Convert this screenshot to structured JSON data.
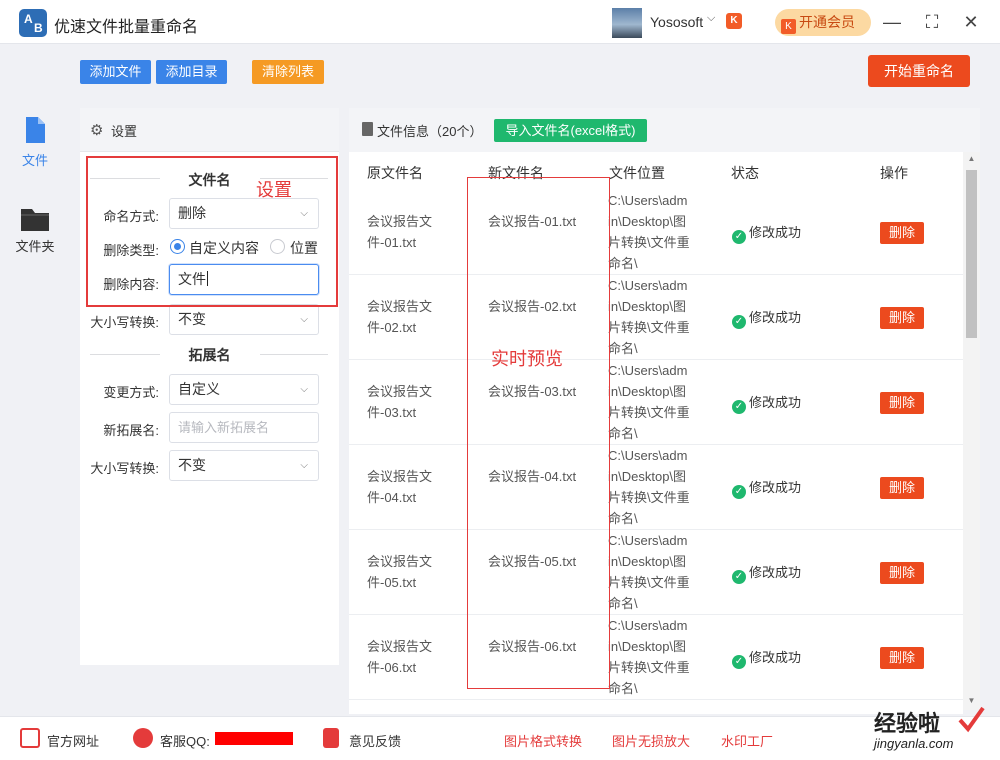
{
  "app": {
    "logo": [
      "A",
      "B"
    ],
    "title": "优速文件批量重命名"
  },
  "user": {
    "name": "Yososoft",
    "vip_button": "开通会员",
    "vip_mark": "K"
  },
  "toolbar": {
    "add_file": "添加文件",
    "add_folder": "添加目录",
    "clear_list": "清除列表",
    "start": "开始重命名"
  },
  "nav": [
    {
      "label": "文件"
    },
    {
      "label": "文件夹"
    }
  ],
  "settings": {
    "header": "设置",
    "filename_section": "文件名",
    "naming_mode_label": "命名方式:",
    "naming_mode_value": "删除",
    "delete_type_label": "删除类型:",
    "delete_type_options": [
      "自定义内容",
      "位置"
    ],
    "delete_content_label": "删除内容:",
    "delete_content_value": "文件",
    "case_label": "大小写转换:",
    "case_value": "不变",
    "ext_section": "拓展名",
    "ext_mode_label": "变更方式:",
    "ext_mode_value": "自定义",
    "new_ext_label": "新拓展名:",
    "new_ext_placeholder": "请输入新拓展名",
    "ext_case_label": "大小写转换:",
    "ext_case_value": "不变"
  },
  "annotations": {
    "settings": "设置",
    "preview": "实时预览"
  },
  "file_panel": {
    "title": "文件信息（20个）",
    "import_button": "导入文件名(excel格式)",
    "columns": [
      "原文件名",
      "新文件名",
      "文件位置",
      "状态",
      "操作"
    ],
    "rows": [
      {
        "orig": "会议报告文件-01.txt",
        "new": "会议报告-01.txt",
        "loc": "C:\\Users\\admin\\Desktop\\图片转换\\文件重命名\\",
        "status": "修改成功",
        "action": "删除"
      },
      {
        "orig": "会议报告文件-02.txt",
        "new": "会议报告-02.txt",
        "loc": "C:\\Users\\admin\\Desktop\\图片转换\\文件重命名\\",
        "status": "修改成功",
        "action": "删除"
      },
      {
        "orig": "会议报告文件-03.txt",
        "new": "会议报告-03.txt",
        "loc": "C:\\Users\\admin\\Desktop\\图片转换\\文件重命名\\",
        "status": "修改成功",
        "action": "删除"
      },
      {
        "orig": "会议报告文件-04.txt",
        "new": "会议报告-04.txt",
        "loc": "C:\\Users\\admin\\Desktop\\图片转换\\文件重命名\\",
        "status": "修改成功",
        "action": "删除"
      },
      {
        "orig": "会议报告文件-05.txt",
        "new": "会议报告-05.txt",
        "loc": "C:\\Users\\admin\\Desktop\\图片转换\\文件重命名\\",
        "status": "修改成功",
        "action": "删除"
      },
      {
        "orig": "会议报告文件-06.txt",
        "new": "会议报告-06.txt",
        "loc": "C:\\Users\\admin\\Desktop\\图片转换\\文件重命名\\",
        "status": "修改成功",
        "action": "删除"
      }
    ]
  },
  "footer": {
    "website": "官方网址",
    "support": "客服QQ:",
    "feedback": "意见反馈",
    "links": [
      "图片格式转换",
      "图片无损放大",
      "水印工厂"
    ]
  },
  "watermark": {
    "text": "经验啦",
    "url": "jingyanla.com"
  },
  "colors": {
    "primary": "#3a84e8",
    "accent": "#ec4a1e",
    "success": "#1fb86e",
    "annotation": "#e43b3b",
    "clear": "#f59a23"
  }
}
